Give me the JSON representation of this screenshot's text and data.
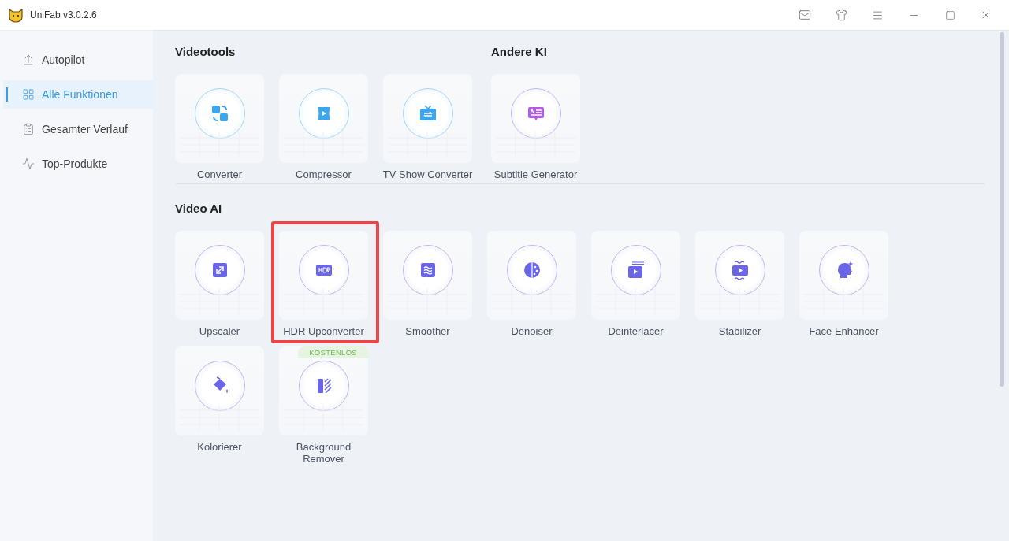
{
  "window": {
    "title": "UniFab v3.0.2.6"
  },
  "sidebar": {
    "items": [
      {
        "label": "Autopilot",
        "selected": false
      },
      {
        "label": "Alle Funktionen",
        "selected": true
      },
      {
        "label": "Gesamter Verlauf",
        "selected": false
      },
      {
        "label": "Top-Produkte",
        "selected": false
      }
    ]
  },
  "top_groups": [
    {
      "title": "Videotools",
      "tools": [
        {
          "label": "Converter",
          "highlighted": false
        },
        {
          "label": "Compressor",
          "highlighted": false
        },
        {
          "label": "TV Show Converter",
          "highlighted": false
        }
      ]
    },
    {
      "title": "Andere KI",
      "tools": [
        {
          "label": "Subtitle Generator",
          "highlighted": false
        }
      ]
    }
  ],
  "video_ai": {
    "title": "Video AI",
    "tools": [
      {
        "label": "Upscaler",
        "highlighted": false
      },
      {
        "label": "HDR Upconverter",
        "highlighted": true
      },
      {
        "label": "Smoother",
        "highlighted": false
      },
      {
        "label": "Denoiser",
        "highlighted": false
      },
      {
        "label": "Deinterlacer",
        "highlighted": false
      },
      {
        "label": "Stabilizer",
        "highlighted": false
      },
      {
        "label": "Face Enhancer",
        "highlighted": false
      },
      {
        "label": "Kolorierer",
        "highlighted": false
      },
      {
        "label": "Background Remover",
        "highlighted": false,
        "badge": "KOSTENLOS"
      }
    ]
  }
}
